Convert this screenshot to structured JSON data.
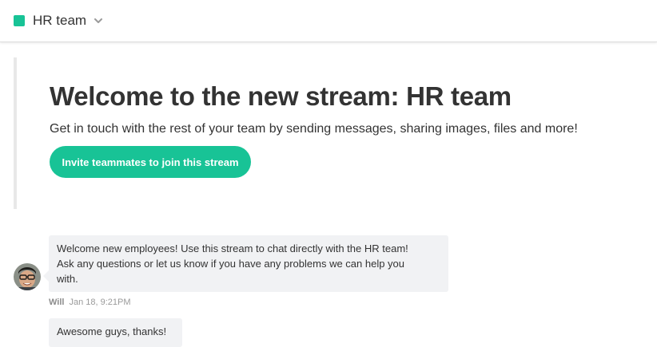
{
  "header": {
    "stream_name": "HR team",
    "stream_color": "#18c396",
    "dropdown_icon": "chevron-down-icon"
  },
  "welcome": {
    "title": "Welcome to the new stream: HR team",
    "subtitle": "Get in touch with the rest of your team by sending messages, sharing images, files and more!",
    "invite_button_label": "Invite teammates to join this stream",
    "button_color": "#18c396"
  },
  "messages": [
    {
      "author": "Will",
      "timestamp": "Jan 18, 9:21PM",
      "text_lines": [
        "Welcome new employees! Use this stream to chat directly with the HR team!",
        "Ask any questions or let us know if you have any problems we can help you",
        "with."
      ]
    },
    {
      "text": "Awesome guys, thanks!"
    }
  ]
}
